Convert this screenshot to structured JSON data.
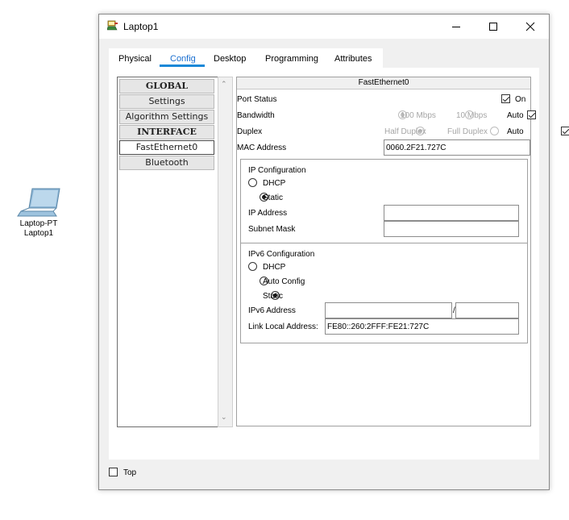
{
  "desktop": {
    "device_type": "Laptop-PT",
    "device_name": "Laptop1"
  },
  "window": {
    "title": "Laptop1",
    "icon": "laptop-app-icon"
  },
  "tabs": [
    {
      "label": "Physical",
      "active": false
    },
    {
      "label": "Config",
      "active": true
    },
    {
      "label": "Desktop",
      "active": false
    },
    {
      "label": "Programming",
      "active": false
    },
    {
      "label": "Attributes",
      "active": false
    }
  ],
  "sidebar": {
    "items": [
      {
        "label": "GLOBAL",
        "type": "header"
      },
      {
        "label": "Settings",
        "type": "item"
      },
      {
        "label": "Algorithm Settings",
        "type": "item"
      },
      {
        "label": "INTERFACE",
        "type": "header"
      },
      {
        "label": "FastEthernet0",
        "type": "item",
        "selected": true
      },
      {
        "label": "Bluetooth",
        "type": "item"
      }
    ]
  },
  "interface": {
    "header": "FastEthernet0",
    "port_status": {
      "label": "Port Status",
      "on_label": "On",
      "on_checked": true
    },
    "bandwidth": {
      "label": "Bandwidth",
      "opt1": "100 Mbps",
      "opt2": "10 Mbps",
      "auto_label": "Auto",
      "auto_checked": true
    },
    "duplex": {
      "label": "Duplex",
      "opt1": "Half Duplex",
      "opt2": "Full Duplex",
      "auto_label": "Auto",
      "auto_checked": true
    },
    "mac": {
      "label": "MAC Address",
      "value": "0060.2F21.727C"
    },
    "ip_config": {
      "title": "IP Configuration",
      "dhcp_label": "DHCP",
      "static_label": "Static",
      "mode": "static",
      "ip_label": "IP Address",
      "ip_value": "",
      "mask_label": "Subnet Mask",
      "mask_value": ""
    },
    "ipv6_config": {
      "title": "IPv6 Configuration",
      "dhcp_label": "DHCP",
      "auto_label": "Auto Config",
      "static_label": "Static",
      "mode": "static",
      "addr_label": "IPv6 Address",
      "addr_value": "",
      "prefix_sep": "/",
      "prefix_value": "",
      "link_local_label": "Link Local Address:",
      "link_local_value": "FE80::260:2FFF:FE21:727C"
    }
  },
  "footer": {
    "top_label": "Top",
    "top_checked": false
  },
  "colors": {
    "accent": "#1a88d8",
    "active_tab_text": "#1a6fd0"
  }
}
